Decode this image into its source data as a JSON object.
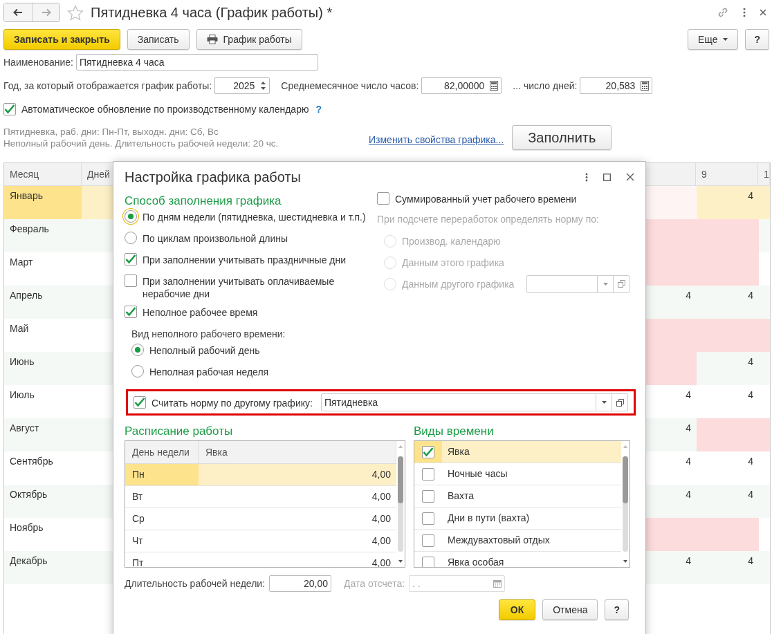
{
  "window": {
    "title": "Пятидневка 4 часа (График работы) *"
  },
  "toolbar": {
    "buttons": [
      {
        "label": "Записать и закрыть",
        "kind": "primary"
      },
      {
        "label": "Записать",
        "kind": "plain"
      },
      {
        "label": "График работы",
        "kind": "print"
      }
    ],
    "more": "Еще",
    "help": "?"
  },
  "form": {
    "name": {
      "label": "Наименование:",
      "value": "Пятидневка 4 часа"
    },
    "year": {
      "label": "Год, за который отображается график работы:",
      "value": "2025"
    },
    "avg_hours": {
      "label": "Среднемесячное число часов:",
      "value": "82,00000"
    },
    "avg_days": {
      "label": "... число дней:",
      "value": "20,583"
    },
    "auto_update": {
      "label": "Автоматическое обновление по производственному календарю",
      "checked": true,
      "help": "?"
    },
    "summary": [
      "Пятидневка, раб. дни: Пн-Пт, выходн. дни: Сб, Вс",
      "Неполный рабочий день. Длительность рабочей недели: 20 чс."
    ],
    "link": "Изменить свойства графика...",
    "fill_button": "Заполнить"
  },
  "grid": {
    "columns": [
      "Месяц",
      "Дней"
    ],
    "day_headers": [
      "9",
      "1"
    ],
    "rows": [
      {
        "month": "Январь",
        "selected": true,
        "days": [
          {
            "kind": "holiday"
          },
          {
            "value": "4",
            "kind": "workday"
          },
          {
            "kind": "workday"
          }
        ]
      },
      {
        "month": "Февраль",
        "selected": false,
        "days": [
          {
            "kind": "holiday"
          },
          {
            "kind": "holiday"
          },
          {
            "kind": "workday"
          }
        ]
      },
      {
        "month": "Март",
        "selected": false,
        "days": [
          {
            "kind": "holiday"
          },
          {
            "kind": "holiday"
          },
          {
            "kind": "workday"
          }
        ]
      },
      {
        "month": "Апрель",
        "selected": false,
        "days": [
          {
            "value": "4",
            "kind": "workday"
          },
          {
            "value": "4",
            "kind": "workday"
          },
          {
            "kind": "workday"
          }
        ]
      },
      {
        "month": "Май",
        "selected": false,
        "days": [
          {
            "kind": "holiday"
          },
          {
            "kind": "holiday"
          },
          {
            "kind": "holiday"
          }
        ]
      },
      {
        "month": "Июнь",
        "selected": false,
        "days": [
          {
            "kind": "holiday"
          },
          {
            "value": "4",
            "kind": "workday"
          },
          {
            "kind": "workday"
          }
        ]
      },
      {
        "month": "Июль",
        "selected": false,
        "days": [
          {
            "value": "4",
            "kind": "workday"
          },
          {
            "value": "4",
            "kind": "workday"
          },
          {
            "kind": "workday"
          }
        ]
      },
      {
        "month": "Август",
        "selected": false,
        "days": [
          {
            "value": "4",
            "kind": "workday"
          },
          {
            "kind": "holiday"
          },
          {
            "kind": "holiday"
          }
        ]
      },
      {
        "month": "Сентябрь",
        "selected": false,
        "days": [
          {
            "value": "4",
            "kind": "workday"
          },
          {
            "value": "4",
            "kind": "workday"
          },
          {
            "kind": "workday"
          }
        ]
      },
      {
        "month": "Октябрь",
        "selected": false,
        "days": [
          {
            "value": "4",
            "kind": "workday"
          },
          {
            "value": "4",
            "kind": "workday"
          },
          {
            "kind": "workday"
          }
        ]
      },
      {
        "month": "Ноябрь",
        "selected": false,
        "days": [
          {
            "kind": "holiday"
          },
          {
            "kind": "holiday"
          },
          {
            "kind": "workday"
          }
        ]
      },
      {
        "month": "Декабрь",
        "selected": false,
        "days": [
          {
            "value": "4",
            "kind": "workday"
          },
          {
            "value": "4",
            "kind": "workday"
          },
          {
            "kind": "workday"
          }
        ]
      }
    ]
  },
  "dialog": {
    "title": "Настройка графика работы",
    "fill_method": {
      "heading": "Способ заполнения графика",
      "options": [
        {
          "label": "По дням недели (пятидневка, шестидневка и т.п.)",
          "selected": true,
          "focused": true
        },
        {
          "label": "По циклам произвольной длины",
          "selected": false,
          "focused": false
        }
      ]
    },
    "options": [
      {
        "label": "При заполнении учитывать праздничные дни",
        "checked": true
      },
      {
        "label": "При заполнении учитывать оплачиваемые нерабочие дни",
        "checked": false
      }
    ],
    "part_time": {
      "label": "Неполное рабочее время",
      "checked": true
    },
    "part_time_kind": {
      "label": "Вид неполного рабочего времени:",
      "options": [
        {
          "label": "Неполный рабочий день",
          "selected": true
        },
        {
          "label": "Неполная рабочая неделя",
          "selected": false
        }
      ]
    },
    "summed": {
      "label": "Суммированный учет рабочего времени",
      "checked": false
    },
    "overtime": {
      "label": "При подсчете переработок определять норму по:",
      "disabled": true,
      "options": [
        {
          "label": "Производ. календарю",
          "selected": false
        },
        {
          "label": "Данным этого графика",
          "selected": false
        },
        {
          "label": "Данным другого графика",
          "selected": false
        }
      ]
    },
    "norm_other": {
      "label": "Считать норму по другому графику:",
      "checked": true,
      "value": "Пятидневка",
      "highlighted": true
    },
    "schedule": {
      "heading": "Расписание работы",
      "columns": [
        "День недели",
        "Явка"
      ],
      "rows": [
        {
          "day": "Пн",
          "hours": "4,00",
          "selected": true
        },
        {
          "day": "Вт",
          "hours": "4,00",
          "selected": false
        },
        {
          "day": "Ср",
          "hours": "4,00",
          "selected": false
        },
        {
          "day": "Чт",
          "hours": "4,00",
          "selected": false
        },
        {
          "day": "Пт",
          "hours": "4,00",
          "selected": false
        }
      ]
    },
    "time_kinds": {
      "heading": "Виды времени",
      "items": [
        {
          "label": "Явка",
          "checked": true,
          "selected": true
        },
        {
          "label": "Ночные часы",
          "checked": false,
          "selected": false
        },
        {
          "label": "Вахта",
          "checked": false,
          "selected": false
        },
        {
          "label": "Дни в пути (вахта)",
          "checked": false,
          "selected": false
        },
        {
          "label": "Междувахтовый отдых",
          "checked": false,
          "selected": false
        },
        {
          "label": "Явка особая",
          "checked": false,
          "selected": false
        }
      ]
    },
    "week_length": {
      "label": "Длительность рабочей недели:",
      "value": "20,00"
    },
    "start_date": {
      "label": "Дата отсчета:",
      "placeholder": ". .",
      "disabled": true
    },
    "buttons": {
      "ok": "ОК",
      "cancel": "Отмена",
      "help": "?"
    }
  }
}
